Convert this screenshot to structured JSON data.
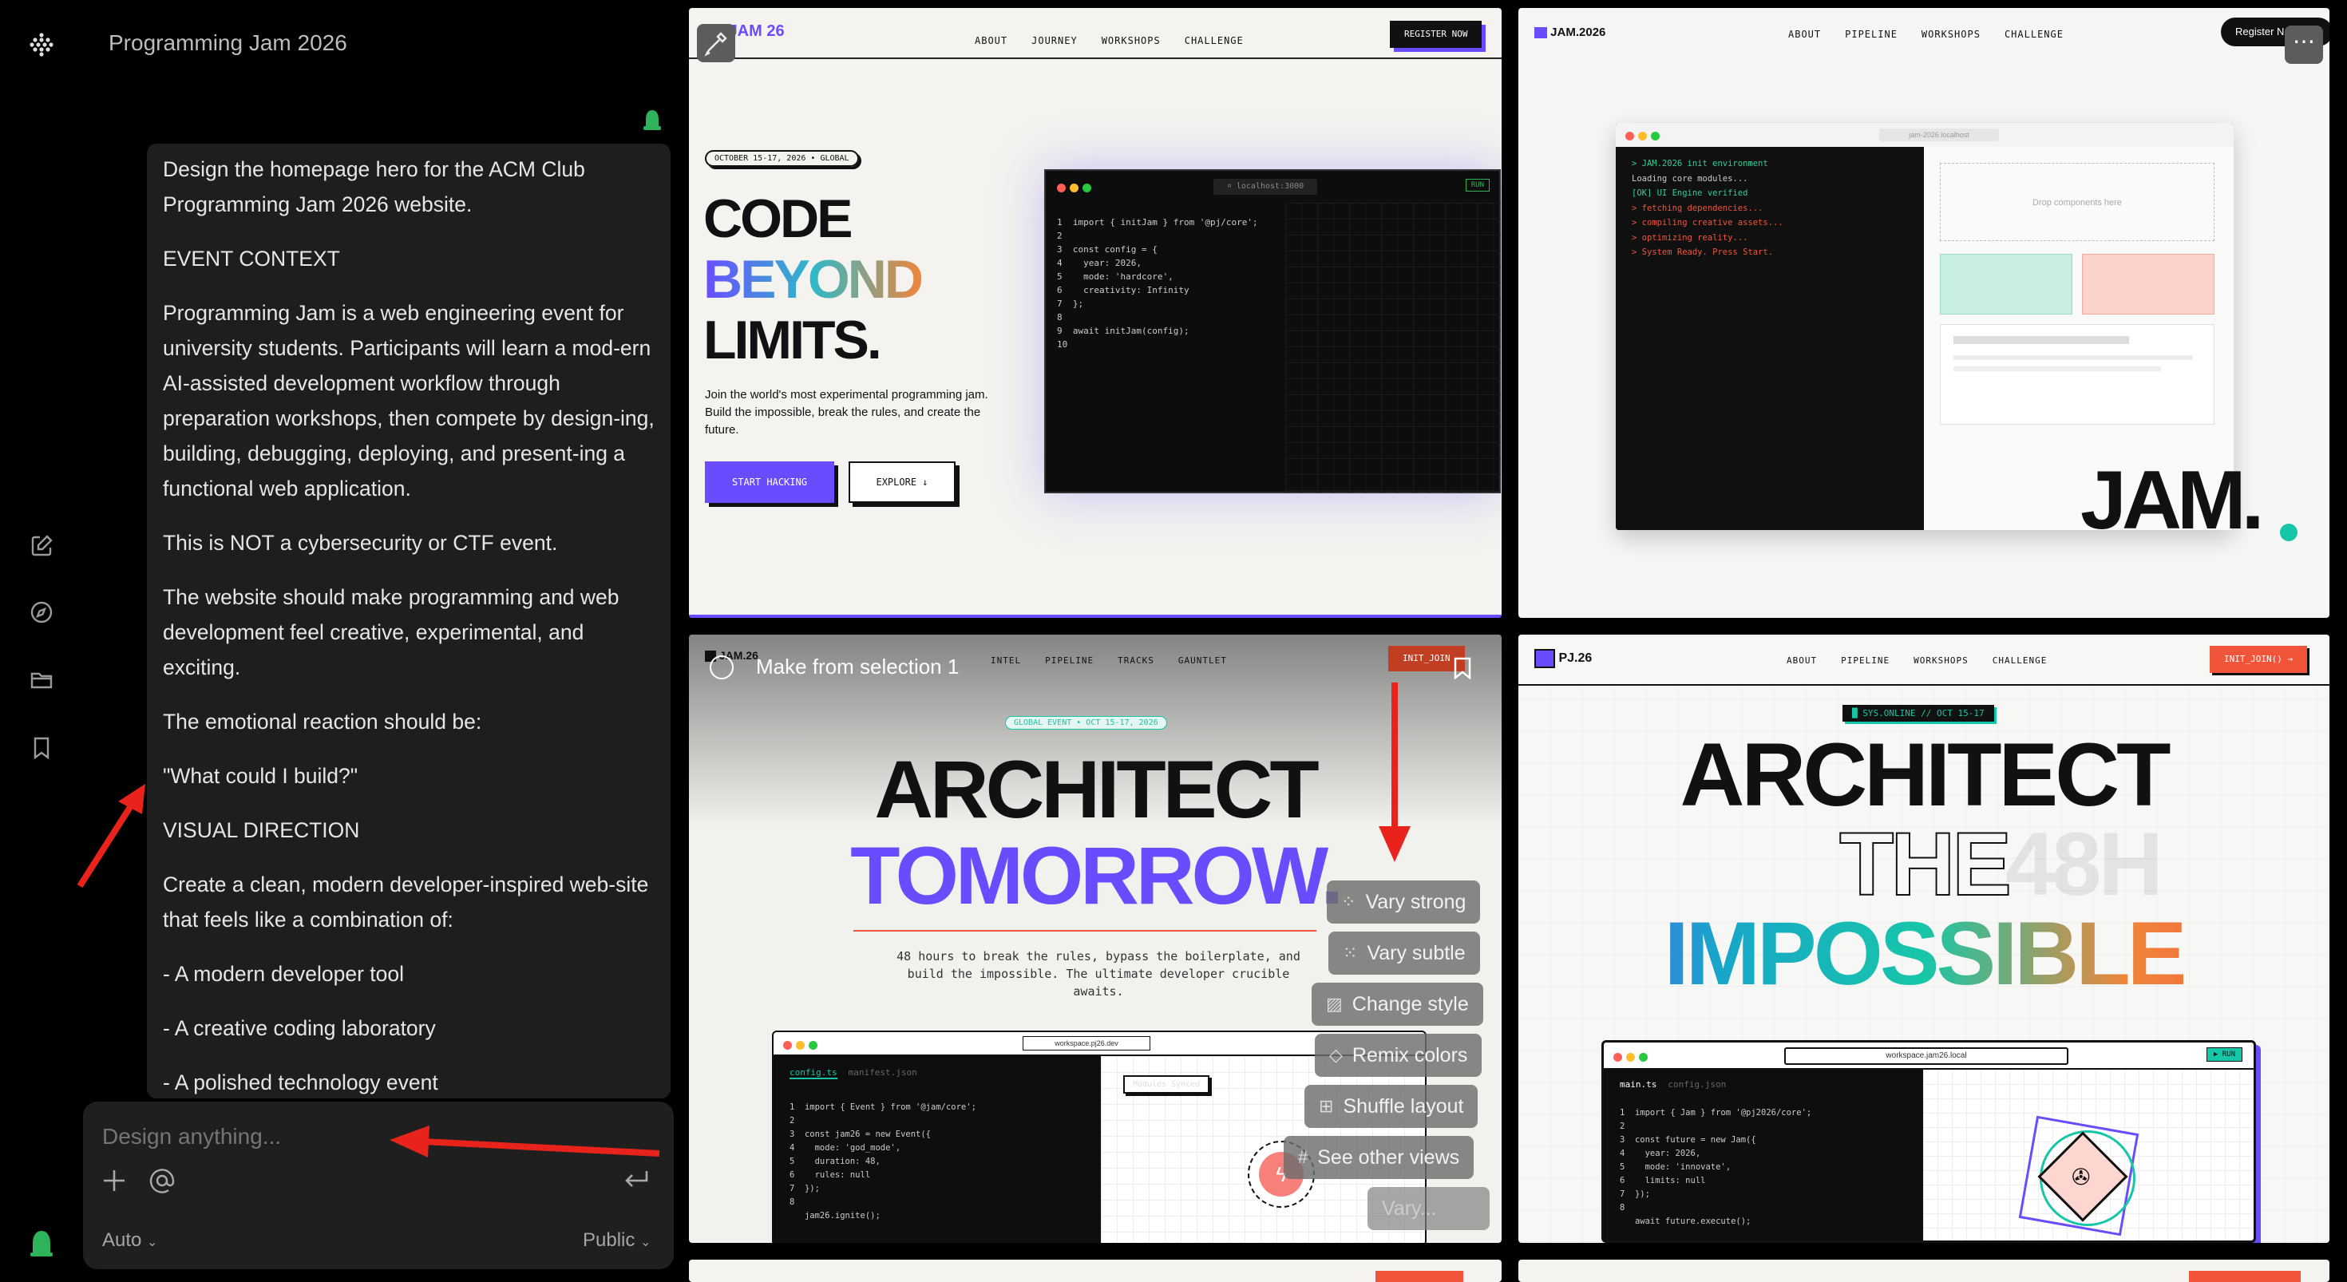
{
  "app": {
    "project_title": "Programming Jam 2026"
  },
  "chat": {
    "paragraphs": [
      "Design the homepage hero for the ACM Club Programming Jam 2026 website.",
      "EVENT CONTEXT",
      "Programming Jam is a web engineering event for university students. Participants will learn a mod-ern AI-assisted development workflow through preparation workshops, then compete by design-ing, building, debugging, deploying, and present-ing a functional web application.",
      "This is NOT a cybersecurity or CTF event.",
      "The website should make programming and web development feel creative, experimental, and exciting.",
      "The emotional reaction should be:",
      "\"What could I build?\"",
      "VISUAL DIRECTION",
      "Create a clean, modern developer-inspired web-site that feels like a combination of:",
      "- A modern developer tool",
      "- A creative coding laboratory",
      "- A polished technology event"
    ]
  },
  "composer": {
    "placeholder": "Design anything...",
    "mode": "Auto",
    "visibility": "Public"
  },
  "card1": {
    "logo": "JAM 26",
    "nav": [
      "ABOUT",
      "JOURNEY",
      "WORKSHOPS",
      "CHALLENGE"
    ],
    "cta": "REGISTER NOW",
    "badge": "OCTOBER 15-17, 2026 • GLOBAL",
    "headline": [
      "CODE",
      "BEYOND",
      "LIMITS."
    ],
    "body": "Join the world's most experimental programming jam. Build the impossible, break the rules, and create the future.",
    "btn_primary": "START HACKING",
    "btn_secondary": "EXPLORE ↓",
    "url": "⌕ localhost:3000",
    "run": "RUN",
    "code": "1  import { initJam } from '@pj/core';\n2\n3  const config = {\n4    year: 2026,\n5    mode: 'hardcore',\n6    creativity: Infinity\n7  };\n8\n9  await initJam(config);\n10"
  },
  "card2": {
    "logo": "JAM.2026",
    "nav": [
      "ABOUT",
      "PIPELINE",
      "WORKSHOPS",
      "CHALLENGE"
    ],
    "cta": "Register N",
    "url": "jam-2026.localhost",
    "terminal": [
      "> JAM.2026 init environment",
      "Loading core modules...",
      "[OK] UI Engine verified",
      "> fetching dependencies...",
      "> compiling creative assets...",
      "> optimizing reality...",
      "> System Ready. Press Start."
    ],
    "dropzone": "Drop components here",
    "wordmark": "JAM."
  },
  "card3": {
    "logo": "JAM.26",
    "nav": [
      "INTEL",
      "PIPELINE",
      "TRACKS",
      "GAUNTLET"
    ],
    "cta": "INIT_JOIN",
    "selection_label": "Make from selection 1",
    "badge": "GLOBAL EVENT • OCT 15-17, 2026",
    "headline": [
      "ARCHITECT",
      "TOMORROW."
    ],
    "body": "48 hours to break the rules, bypass the boilerplate, and build the impossible. The ultimate developer crucible awaits.",
    "url": "workspace.pj26.dev",
    "tabs": [
      "config.ts",
      "manifest.json"
    ],
    "synced": "Modules Synced",
    "code": "1  import { Event } from '@jam/core';\n2\n3  const jam26 = new Event({\n4    mode: 'god_mode',\n5    duration: 48,\n6    rules: null\n7  });\n8\n   jam26.ignite();"
  },
  "card4": {
    "logo": "PJ.26",
    "nav": [
      "ABOUT",
      "PIPELINE",
      "WORKSHOPS",
      "CHALLENGE"
    ],
    "cta": "INIT_JOIN() →",
    "badge": "█ SYS.ONLINE // OCT 15-17",
    "headline": [
      "ARCHITECT",
      "THE",
      "IMPOSSIBLE"
    ],
    "ghost": "48H",
    "url": "workspace.jam26.local",
    "run": "▶ RUN",
    "tabs": [
      "main.ts",
      "config.json"
    ],
    "code": "1  import { Jam } from '@pj2026/core';\n2\n3  const future = new Jam({\n4    year: 2026,\n5    mode: 'innovate',\n6    limits: null\n7  });\n8\n   await future.execute();"
  },
  "vary_menu": [
    "Vary strong",
    "Vary subtle",
    "Change style",
    "Remix colors",
    "Shuffle layout",
    "See other views",
    "Vary..."
  ],
  "colors": {
    "purple": "#6a4cff",
    "orange": "#f0553a",
    "teal": "#17c6a8",
    "panel": "#1e1e1e"
  }
}
